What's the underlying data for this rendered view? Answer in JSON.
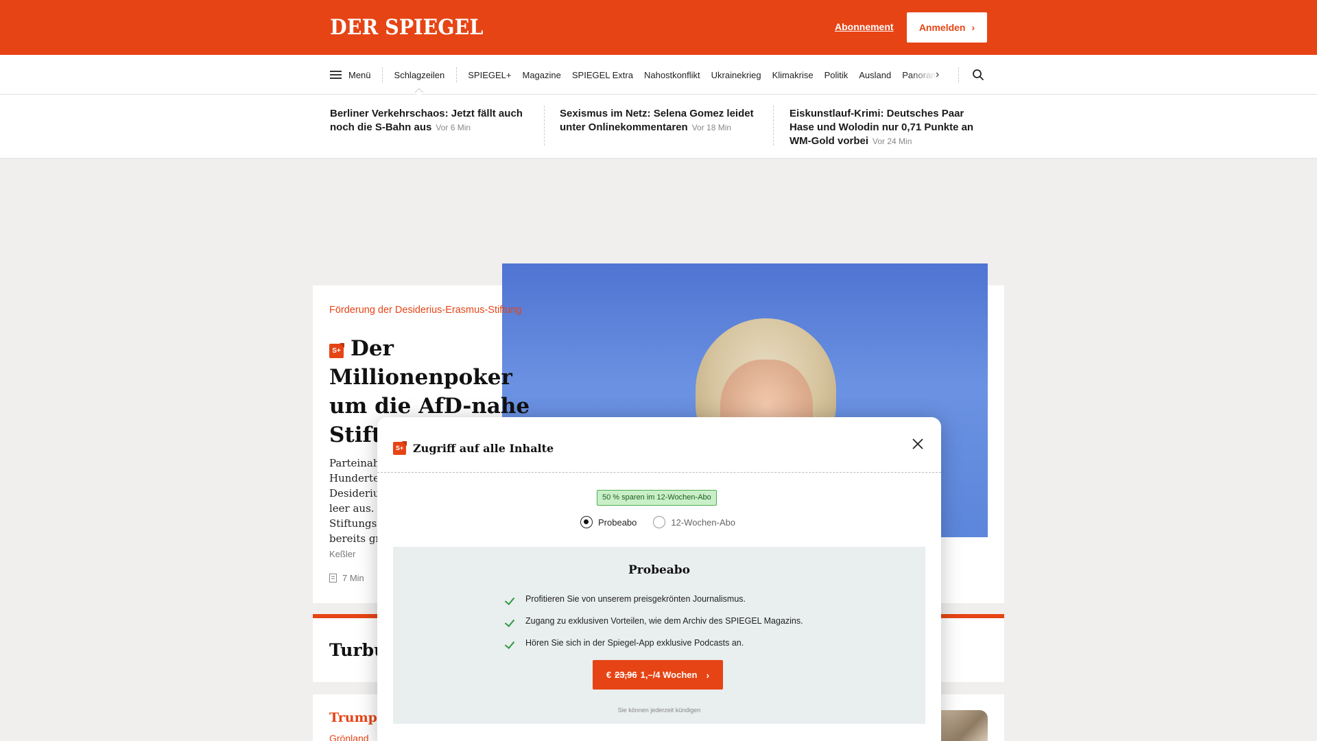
{
  "header": {
    "logo": "DER SPIEGEL",
    "subscription_link": "Abonnement",
    "login_button": "Anmelden",
    "brand_color": "#e64415"
  },
  "nav": {
    "menu_label": "Menü",
    "active_item": "Schlagzeilen",
    "items": [
      "SPIEGEL+",
      "Magazine",
      "SPIEGEL Extra",
      "Nahostkonflikt",
      "Ukrainekrieg",
      "Klimakrise",
      "Politik",
      "Ausland",
      "Panorama"
    ]
  },
  "headlines": [
    {
      "title": "Berliner Verkehrschaos: Jetzt fällt auch noch die S-Bahn aus",
      "time": "Vor 6 Min"
    },
    {
      "title": "Sexismus im Netz: Selena Gomez leidet unter Onlinekommentaren",
      "time": "Vor 18 Min"
    },
    {
      "title": "Eiskunstlauf-Krimi: Deutsches Paar Hase und Wolodin nur 0,71 Punkte an WM-Gold vorbei",
      "time": "Vor 24 Min"
    }
  ],
  "article": {
    "kicker": "Förderung der Desiderius-Erasmus-Stiftung",
    "badge": "S+",
    "title": "Der Millionenpoker um die AfD-nahe Stiftung",
    "body_lines": [
      "Parteinahe",
      "Hunderte",
      "Desideriu",
      "leer aus. A",
      "Stiftungsc",
      "bereits gro"
    ],
    "author": "Keßler",
    "read_time": "7 Min"
  },
  "card2": {
    "title": "Turbul"
  },
  "card3": {
    "kicker": "Trump a",
    "sub": "Grönland"
  },
  "modal": {
    "badge": "S+",
    "title": "Zugriff auf alle Inhalte",
    "savings_badge": "50 % sparen im 12-Wochen-Abo",
    "options": [
      {
        "label": "Probeabo",
        "selected": true
      },
      {
        "label": "12-Wochen-Abo",
        "selected": false
      }
    ],
    "plan": {
      "title": "Probeabo",
      "benefits": [
        "Profitieren Sie von unserem preisgekrönten Journalismus.",
        "Zugang zu exklusiven Vorteilen, wie dem Archiv des SPIEGEL Magazins.",
        "Hören Sie sich in der Spiegel-App exklusive Podcasts an."
      ],
      "cta_currency": "€",
      "cta_old_price": "23,96",
      "cta_new_price": "1,–/4 Wochen",
      "cancel_note": "Sie können jederzeit kündigen"
    }
  }
}
